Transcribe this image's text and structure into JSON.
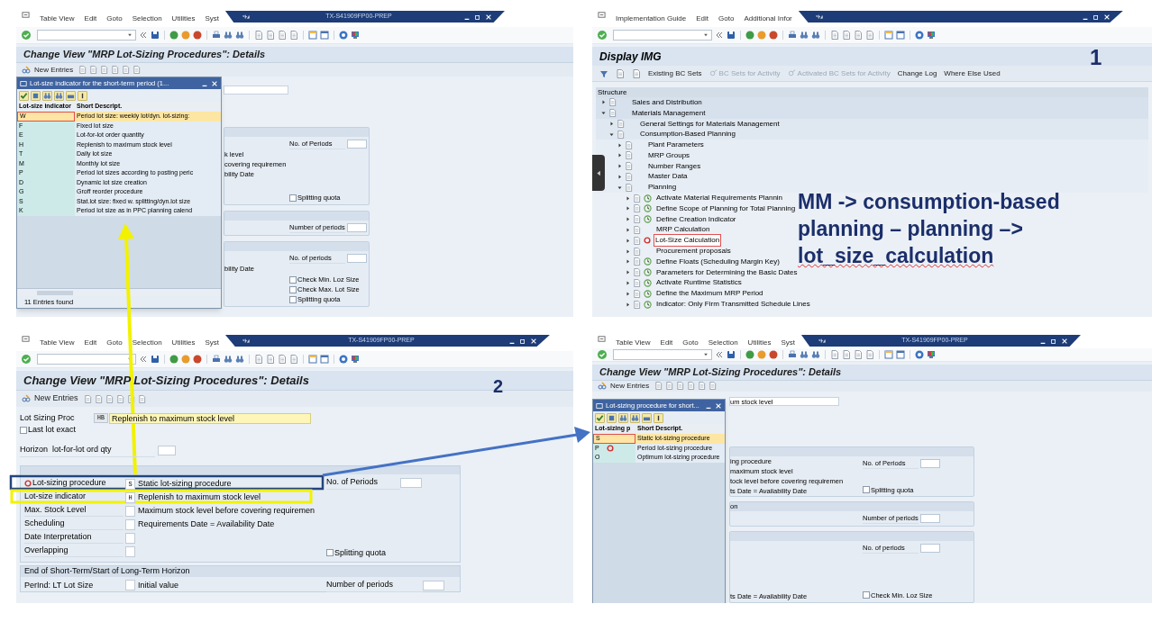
{
  "top_left": {
    "menu": [
      "Table View",
      "Edit",
      "Goto",
      "Selection",
      "Utilities",
      "Syst"
    ],
    "host": "TX-S41909FP00-PREP",
    "title": "Change View \"MRP Lot-Sizing Procedures\": Details",
    "new_entries": "New Entries",
    "popup": {
      "title": "Lot-size indicator for the short-term period (1...",
      "columns": [
        "Lot-size indicator",
        "Short Descript."
      ],
      "rows": [
        {
          "key": "W",
          "text": "Period lot size: weekly lot/dyn. lot-sizing:",
          "selected": true
        },
        {
          "key": "F",
          "text": "Fixed lot size",
          "selected": false
        },
        {
          "key": "E",
          "text": "Lot-for-lot order quantity",
          "selected": false
        },
        {
          "key": "H",
          "text": "Replenish to maximum stock level",
          "selected": false
        },
        {
          "key": "T",
          "text": "Daily lot size",
          "selected": false
        },
        {
          "key": "M",
          "text": "Monthly lot size",
          "selected": false
        },
        {
          "key": "P",
          "text": "Period lot sizes according to posting peric",
          "selected": false
        },
        {
          "key": "D",
          "text": "Dynamic lot size creation",
          "selected": false
        },
        {
          "key": "G",
          "text": "Groff reorder procedure",
          "selected": false
        },
        {
          "key": "S",
          "text": "Stat.lot size: fixed w. splitting/dyn.lot size",
          "selected": false
        },
        {
          "key": "K",
          "text": "Period lot size as in PPC planning calend",
          "selected": false
        }
      ],
      "footer": "11 Entries found"
    },
    "groups": [
      {
        "lines": [
          "k level",
          "covering requiremen",
          "bility Date"
        ],
        "fields": [
          {
            "kind": "input",
            "label": "No. of Periods"
          },
          {
            "kind": "checkbox",
            "label": "Splitting quota",
            "checked": false
          }
        ]
      },
      {
        "fields": [
          {
            "kind": "input",
            "label": "Number of periods"
          }
        ]
      },
      {
        "lines": [
          "bility Date"
        ],
        "fields": [
          {
            "kind": "input",
            "label": "No. of periods"
          },
          {
            "kind": "checkbox",
            "label": "Check Min. Loz Size",
            "checked": false
          },
          {
            "kind": "checkbox",
            "label": "Check Max. Lot Size",
            "checked": false
          },
          {
            "kind": "checkbox",
            "label": "Splitting quota",
            "checked": false
          }
        ]
      }
    ]
  },
  "top_right": {
    "menu": [
      "Implementation Guide",
      "Edit",
      "Goto",
      "Additional Infor"
    ],
    "title": "Display IMG",
    "label": "1",
    "buttons": [
      {
        "text": "Existing BC Sets",
        "disabled": false
      },
      {
        "text": "BC Sets for Activity",
        "disabled": true
      },
      {
        "text": "Activated BC Sets for Activity",
        "disabled": true
      },
      {
        "text": "Change Log",
        "disabled": false
      },
      {
        "text": "Where Else Used",
        "disabled": false
      }
    ],
    "structure_heading": "Structure",
    "tree": [
      {
        "text": "Sales and Distribution",
        "kind": "folder",
        "expanded": false,
        "selected": false
      },
      {
        "text": "Materials Management",
        "kind": "folder",
        "expanded": true,
        "selected": false,
        "children": [
          {
            "text": "General Settings for Materials Management",
            "kind": "folder",
            "expanded": false,
            "selected": false
          },
          {
            "text": "Consumption-Based Planning",
            "kind": "folder",
            "expanded": true,
            "selected": false,
            "children": [
              {
                "text": "Plant Parameters",
                "kind": "folder",
                "expanded": false,
                "selected": false
              },
              {
                "text": "MRP Groups",
                "kind": "folder",
                "expanded": false,
                "selected": false
              },
              {
                "text": "Number Ranges",
                "kind": "folder",
                "expanded": false,
                "selected": false
              },
              {
                "text": "Master Data",
                "kind": "folder",
                "expanded": false,
                "selected": false
              },
              {
                "text": "Planning",
                "kind": "folder",
                "expanded": true,
                "selected": false,
                "children": [
                  {
                    "text": "Activate Material Requirements Plannin",
                    "kind": "activity",
                    "expanded": false,
                    "selected": false
                  },
                  {
                    "text": "Define Scope of Planning for Total Planning",
                    "kind": "activity",
                    "expanded": false,
                    "selected": false
                  },
                  {
                    "text": "Define Creation Indicator",
                    "kind": "activity",
                    "expanded": false,
                    "selected": false
                  },
                  {
                    "text": "MRP Calculation",
                    "kind": "folder",
                    "expanded": false,
                    "selected": false
                  },
                  {
                    "text": "Lot-Size Calculation",
                    "kind": "folder",
                    "expanded": false,
                    "selected": true,
                    "clicked": true
                  },
                  {
                    "text": "Procurement proposals",
                    "kind": "folder",
                    "expanded": false,
                    "selected": false
                  },
                  {
                    "text": "Define Floats (Scheduling Margin Key)",
                    "kind": "activity",
                    "expanded": false,
                    "selected": false
                  },
                  {
                    "text": "Parameters for Determining the Basic Dates",
                    "kind": "activity",
                    "expanded": false,
                    "selected": false
                  },
                  {
                    "text": "Activate Runtime Statistics",
                    "kind": "activity",
                    "expanded": false,
                    "selected": false
                  },
                  {
                    "text": "Define the Maximum MRP Period",
                    "kind": "activity",
                    "expanded": false,
                    "selected": false
                  },
                  {
                    "text": "Indicator: Only Firm Transmitted Schedule Lines",
                    "kind": "activity",
                    "expanded": false,
                    "selected": false
                  }
                ]
              }
            ]
          }
        ]
      }
    ],
    "note": [
      "MM -> consumption-based",
      "planning – planning –>",
      "lot_size_calculation"
    ]
  },
  "bottom_left": {
    "menu": [
      "Table View",
      "Edit",
      "Goto",
      "Selection",
      "Utilities",
      "Syst"
    ],
    "host": "TX-S41909FP00-PREP",
    "title": "Change View \"MRP Lot-Sizing Procedures\": Details",
    "label": "2",
    "new_entries": "New Entries",
    "lot_sizing_proc": {
      "label": "Lot Sizing Proc",
      "key": "HB",
      "value": "Replenish to maximum stock level"
    },
    "last_lot_exact": {
      "label": "Last lot exact",
      "checked": false
    },
    "horizon": {
      "label": "Horizon  lot-for-lot ord qty"
    },
    "short_term": {
      "rows": [
        {
          "label": "Lot-sizing procedure",
          "key": "S",
          "value": "Static lot-sizing procedure",
          "clicked": true
        },
        {
          "label": "Lot-size indicator",
          "key": "H",
          "value": "Replenish to maximum stock level"
        },
        {
          "label": "Max. Stock Level",
          "value": "Maximum stock level before covering requiremen"
        },
        {
          "label": "Scheduling",
          "value": "Requirements Date = Availability Date"
        },
        {
          "label": "Date Interpretation"
        },
        {
          "label": "Overlapping"
        }
      ],
      "periods_label": "No. of Periods",
      "splitting_quota": {
        "label": "Splitting quota",
        "checked": false
      }
    },
    "end_short_term": {
      "heading": "End of Short-Term/Start of Long-Term Horizon",
      "label": "PerInd: LT Lot Size",
      "value": "Initial value",
      "periods_label": "Number of periods"
    }
  },
  "bottom_right": {
    "menu": [
      "Table View",
      "Edit",
      "Goto",
      "Selection",
      "Utilities",
      "Syst"
    ],
    "host": "TX-S41909FP00-PREP",
    "title": "Change View \"MRP Lot-Sizing Procedures\": Details",
    "new_entries": "New Entries",
    "top_field": "um stock level",
    "popup": {
      "title": "Lot-sizing procedure for short...",
      "columns": [
        "Lot-sizing p",
        "Short Descript."
      ],
      "rows": [
        {
          "key": "S",
          "text": "Static lot-sizing procedure",
          "selected": true
        },
        {
          "key": "P",
          "text": "Period lot-sizing procedure",
          "selected": false,
          "clicked": true
        },
        {
          "key": "O",
          "text": "Optimum lot-sizing procedure",
          "selected": false
        }
      ]
    },
    "groups": [
      {
        "lines": [
          "ing procedure",
          "maximum stock level",
          "tock level before covering requiremen",
          "ts Date = Availability Date"
        ],
        "fields": [
          {
            "kind": "input",
            "label": "No. of Periods"
          },
          {
            "kind": "checkbox",
            "label": "Splitting quota",
            "checked": false
          }
        ]
      },
      {
        "heading": "on",
        "fields": [
          {
            "kind": "input",
            "label": "Number of periods"
          }
        ]
      },
      {
        "lines": [
          "ts Date = Availability Date"
        ],
        "fields": [
          {
            "kind": "input",
            "label": "No. of periods"
          },
          {
            "kind": "checkbox",
            "label": "Check Min. Loz Size",
            "checked": false
          }
        ]
      }
    ]
  }
}
